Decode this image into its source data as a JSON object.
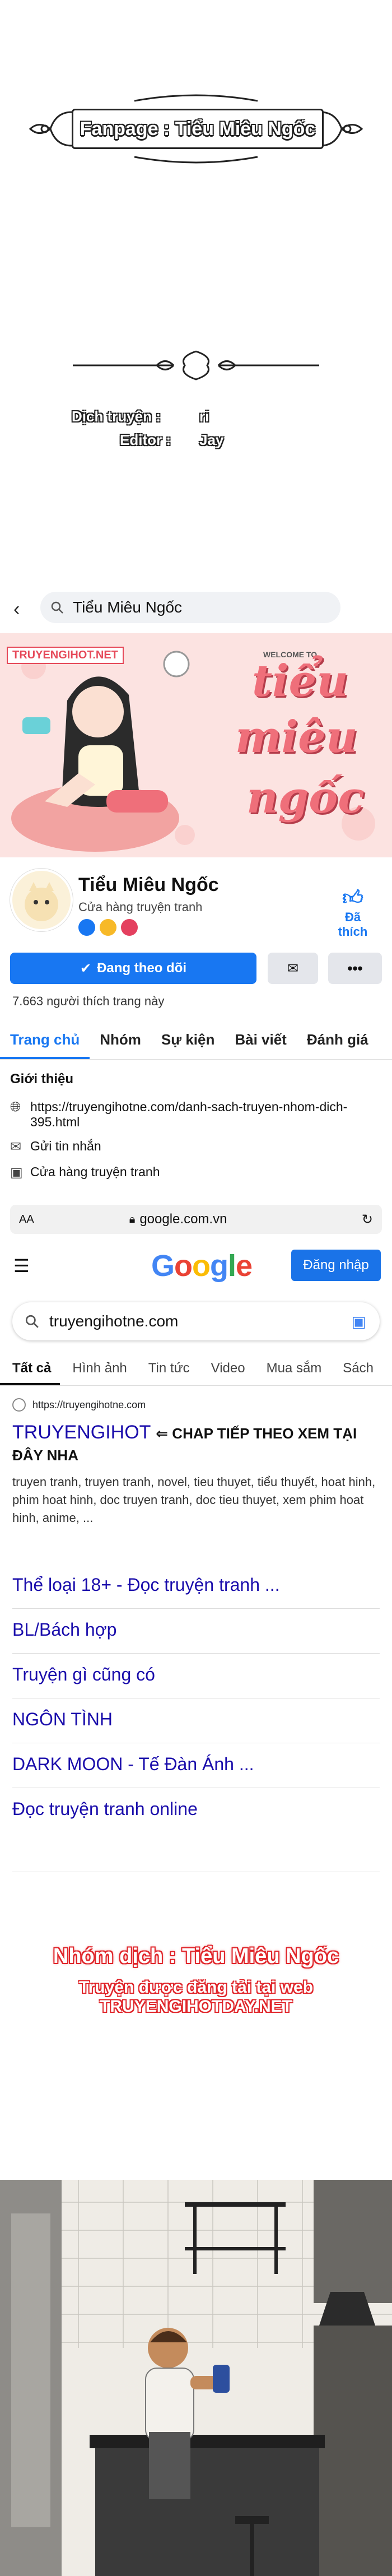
{
  "credits": {
    "fanpage": "Fanpage : Tiểu Miêu Ngốc",
    "translator_label": "Dịch truyện :",
    "translator_name": "ri",
    "editor_label": "Editor :",
    "editor_name": "Jay"
  },
  "facebook": {
    "search_query": "Tiểu Miêu Ngốc",
    "cover_watermark": "TRUYENGIHOT.NET",
    "cover_welcome": "WELCOME TO",
    "cover_title_1": "tiểu",
    "cover_title_2": "miêu",
    "cover_title_3": "ngốc",
    "page_name": "Tiểu Miêu Ngốc",
    "page_category": "Cửa hàng truyện tranh",
    "like_label": "Đã thích",
    "follow_label": "Đang theo dõi",
    "more_label": "•••",
    "likes_count": "7.663 người thích trang này",
    "tabs": [
      "Trang chủ",
      "Nhóm",
      "Sự kiện",
      "Bài viết",
      "Đánh giá"
    ],
    "intro_heading": "Giới thiệu",
    "intro_link": "https://truyengihotne.com/danh-sach-truyen-nhom-dich-395.html",
    "intro_message": "Gửi tin nhắn",
    "intro_category": "Cửa hàng truyện tranh",
    "accent": "#1877f2"
  },
  "browser": {
    "text_size": "AA",
    "url": "google.com.vn",
    "signin_label": "Đăng nhập",
    "search_query": "truyengihotne.com",
    "tabs": [
      "Tất cả",
      "Hình ảnh",
      "Tin tức",
      "Video",
      "Mua sắm",
      "Sách"
    ],
    "result_site": "https://truyengihotne.com",
    "result_title_a": "TRUYENGIHOT",
    "result_title_b": "⇐ CHAP TIẾP THEO XEM TẠI ĐÂY NHA",
    "result_snippet": "truyen tranh, truyen tranh, novel, tieu thuyet, tiểu thuyết, hoat hinh, phim hoat hinh, doc truyen tranh, doc tieu thuyet, xem phim hoat hinh, anime, ...",
    "sitelinks": [
      "Thể loại 18+ - Đọc truyện tranh ...",
      "BL/Bách hợp",
      "Truyện gì cũng có",
      "NGÔN TÌNH",
      "DARK MOON - Tế Đàn Ánh ...",
      "Đọc truyện tranh online"
    ]
  },
  "footer": {
    "group": "Nhóm dịch : Tiểu Miêu Ngốc",
    "site": "Truyện được đăng tải tại web TRUYENGIHOTDAY.NET"
  }
}
